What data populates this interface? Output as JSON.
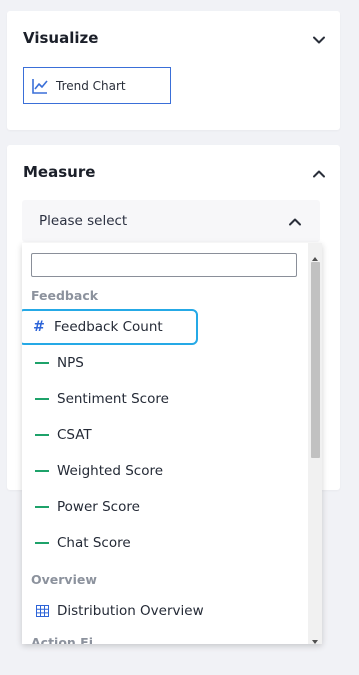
{
  "visualize": {
    "title": "Visualize",
    "chart_button_label": "Trend Chart"
  },
  "measure": {
    "title": "Measure",
    "select_placeholder": "Please select",
    "search_value": "",
    "groups": [
      {
        "label": "Feedback",
        "items": [
          {
            "label": "Feedback Count",
            "icon": "hash-icon",
            "highlighted": true
          },
          {
            "label": "NPS",
            "icon": "measure-list-icon"
          },
          {
            "label": "Sentiment Score",
            "icon": "measure-list-icon"
          },
          {
            "label": "CSAT",
            "icon": "measure-list-icon"
          },
          {
            "label": "Weighted Score",
            "icon": "measure-list-icon"
          },
          {
            "label": "Power Score",
            "icon": "measure-list-icon"
          },
          {
            "label": "Chat Score",
            "icon": "measure-list-icon"
          }
        ]
      },
      {
        "label": "Overview",
        "items": [
          {
            "label": "Distribution Overview",
            "icon": "table-icon"
          }
        ]
      },
      {
        "label": "Action Fi...",
        "items": []
      }
    ]
  },
  "colors": {
    "accent_blue": "#3a6fd8",
    "highlight_border": "#25a9e6",
    "measure_icon_green": "#1ea26a",
    "group_label_gray": "#8c929d"
  }
}
